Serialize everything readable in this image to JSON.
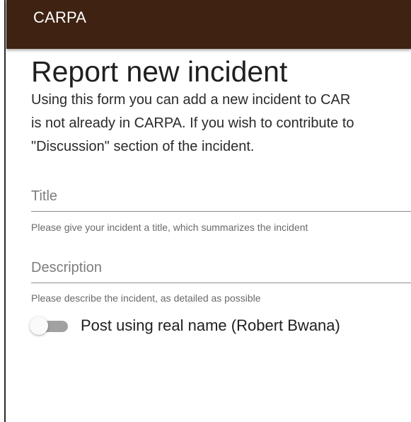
{
  "app": {
    "title": "CARPA",
    "colors": {
      "appbar": "#3f2212",
      "appbar_text": "#ffffff"
    }
  },
  "page": {
    "title": "Report new incident",
    "intro_lines": [
      "Using this form you can add a new incident to CAR",
      "is not already in CARPA. If you wish to contribute to",
      "\"Discussion\" section of the incident."
    ]
  },
  "form": {
    "title_field": {
      "placeholder": "Title",
      "value": "",
      "helper": "Please give your incident a title, which summarizes the incident"
    },
    "description_field": {
      "placeholder": "Description",
      "value": "",
      "helper": "Please describe the incident, as detailed as possible"
    },
    "real_name_toggle": {
      "label": "Post using real name (Robert Bwana)",
      "checked": false
    }
  }
}
